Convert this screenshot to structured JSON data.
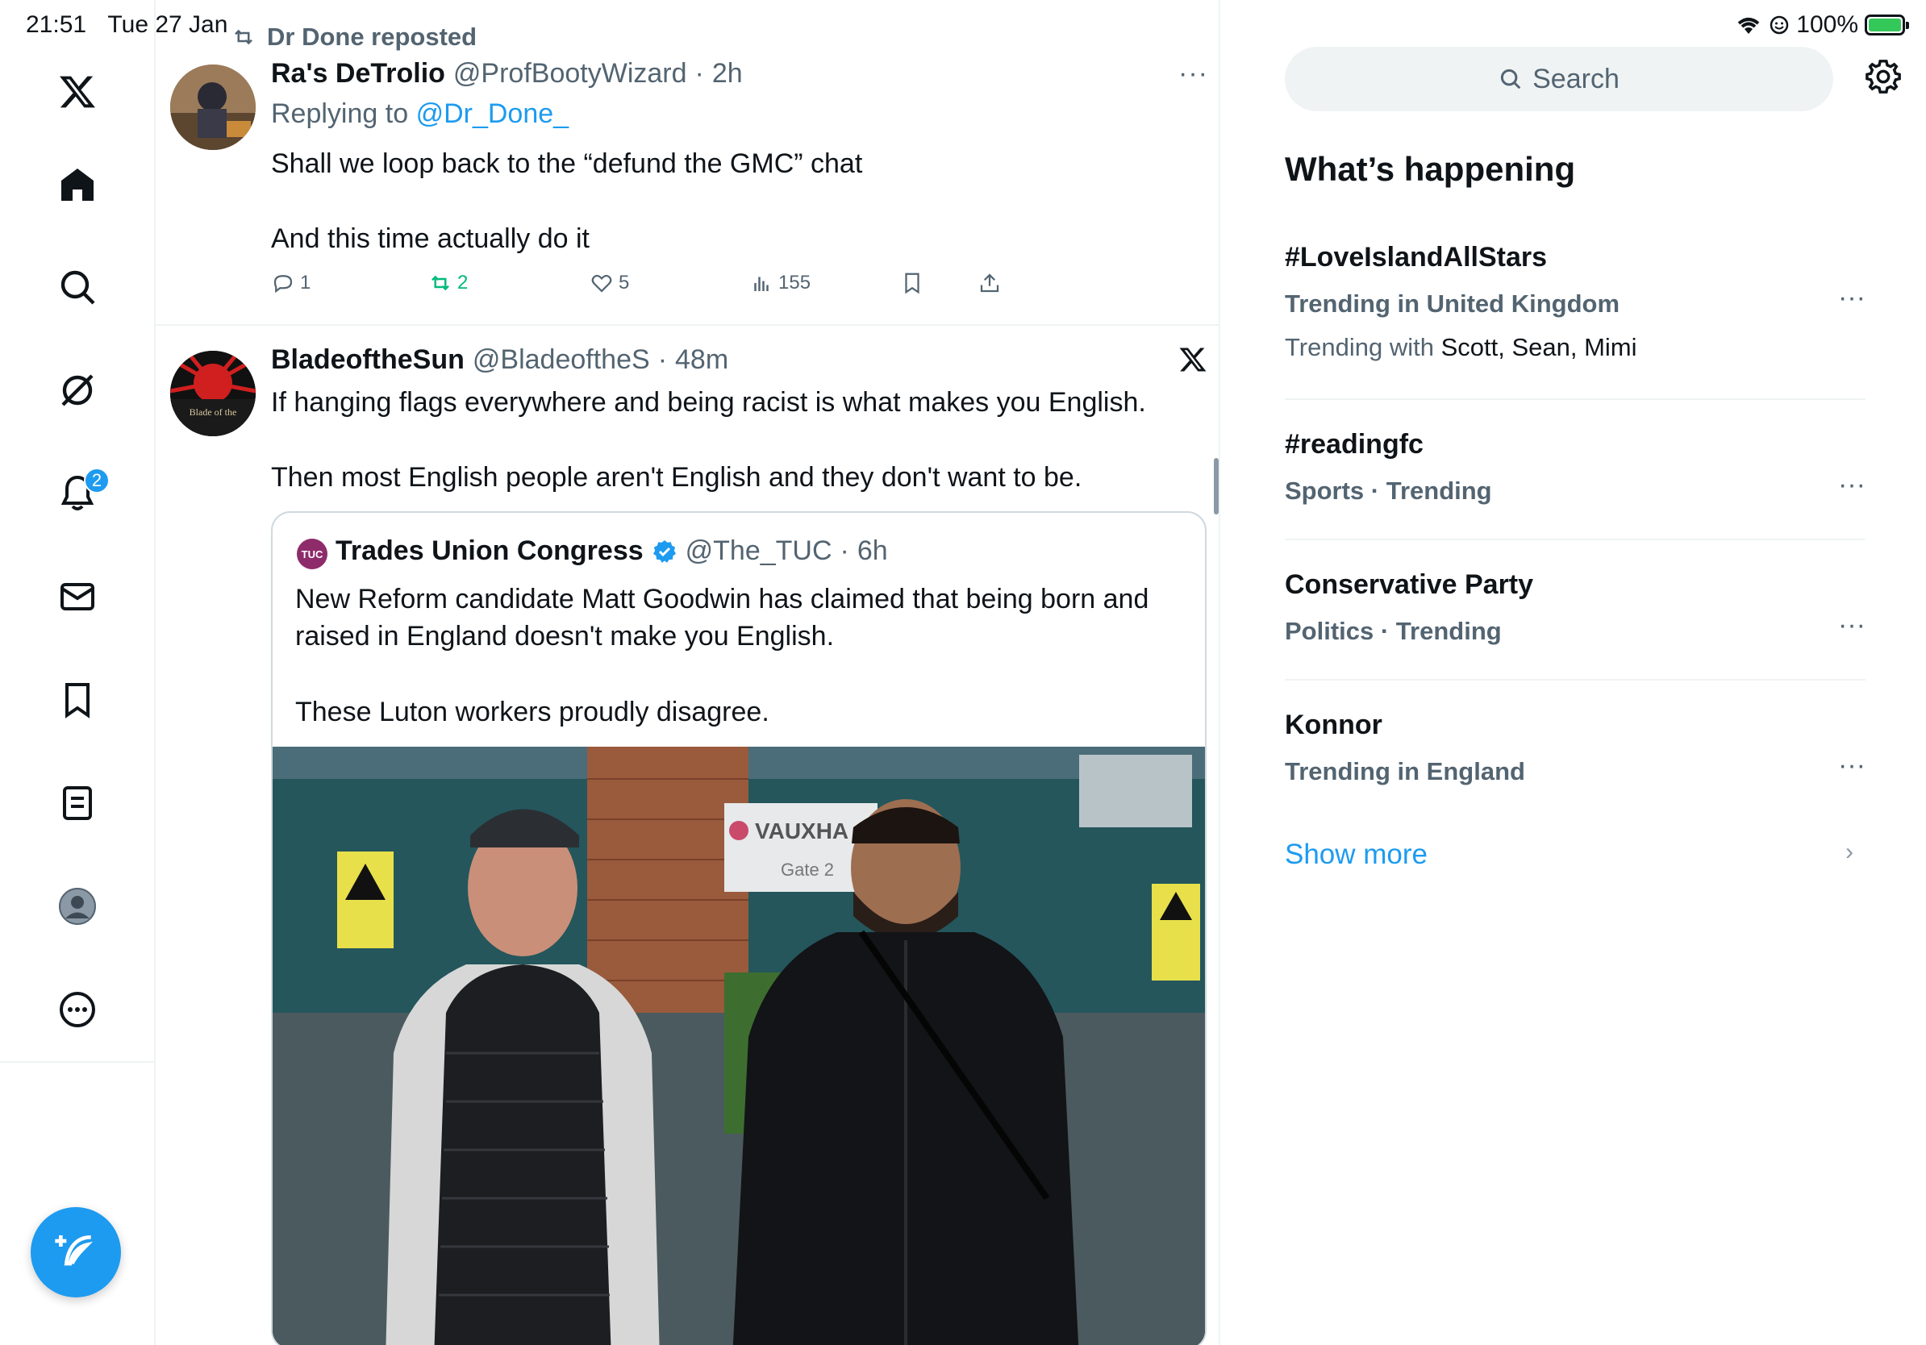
{
  "status_bar": {
    "time": "21:51",
    "date": "Tue 27 Jan",
    "battery": "100%"
  },
  "nav": {
    "items": [
      "x-logo",
      "home",
      "explore",
      "grok",
      "notifications",
      "messages",
      "bookmarks",
      "lists",
      "profile",
      "more"
    ],
    "notifications_badge": "2"
  },
  "feed": {
    "repost_label": "Dr Done reposted",
    "tweet1": {
      "name": "Ra's DeTrolio",
      "handle": "@ProfBootyWizard",
      "sep": "·",
      "time": "2h",
      "replying_prefix": "Replying to",
      "replying_to": "@Dr_Done_",
      "text_line1": "Shall we loop back to the “defund the GMC” chat",
      "text_line2": "And this time actually do it",
      "replies": "1",
      "reposts": "2",
      "likes": "5",
      "views": "155"
    },
    "tweet2": {
      "name": "BladeoftheSun",
      "handle": "@BladeoftheS",
      "sep": "·",
      "time": "48m",
      "text_line1": "If hanging flags everywhere and being racist is what makes you English.",
      "text_line2": "Then most English people aren't English and they don't want to be.",
      "avatar_text": "Blade of the"
    },
    "quote": {
      "avatar_text": "TUC",
      "name": "Trades Union Congress",
      "handle": "@The_TUC",
      "sep": "·",
      "time": "6h",
      "text_line1": "New Reform candidate Matt Goodwin has claimed that being born and raised in England doesn't make you English.",
      "text_line2": "These Luton workers proudly disagree.",
      "media_sign": "VAUXHA",
      "media_gate": "Gate 2"
    }
  },
  "sidebar": {
    "search_placeholder": "Search",
    "title": "What’s happening",
    "trends": [
      {
        "name": "#LoveIslandAllStars",
        "meta": "Trending in United Kingdom",
        "with_prefix": "Trending with",
        "with_names": "Scott, Sean, Mimi"
      },
      {
        "name": "#readingfc",
        "meta": "Sports · Trending"
      },
      {
        "name": "Conservative Party",
        "meta": "Politics · Trending"
      },
      {
        "name": "Konnor",
        "meta": "Trending in England"
      }
    ],
    "show_more": "Show more",
    "dots": "···"
  }
}
